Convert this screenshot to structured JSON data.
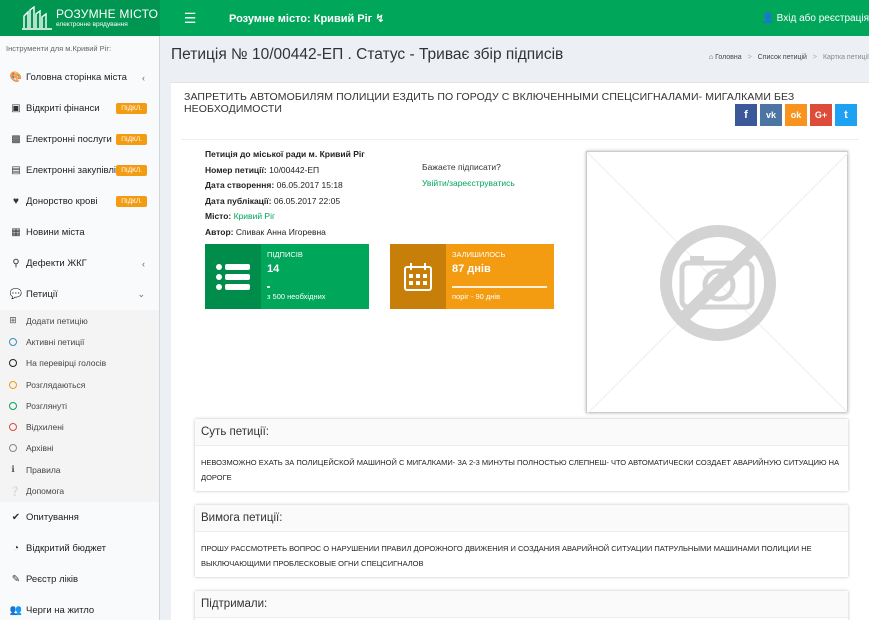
{
  "header": {
    "logo_line1": "РОЗУМНЕ МІСТО",
    "logo_line2": "електронне врядування",
    "menu_icon": "hamburger-icon",
    "city": "Розумне місто: Кривий Ріг",
    "login": "Вхід або реєстрація"
  },
  "sidebar": {
    "heading": "Інструменти для м.Кривий Ріг:",
    "badge": "ПІДКЛ.",
    "items": [
      {
        "label": "Головна сторінка міста",
        "icon": "palette-icon"
      },
      {
        "label": "Відкриті фінанси",
        "icon": "credit-card-icon"
      },
      {
        "label": "Електронні послуги",
        "icon": "briefcase-icon"
      },
      {
        "label": "Електронні закупівлі",
        "icon": "money-icon"
      },
      {
        "label": "Донорство крові",
        "icon": "heartbeat-icon"
      },
      {
        "label": "Новини міста",
        "icon": "newspaper-icon"
      },
      {
        "label": "Дефекти ЖКГ",
        "icon": "search-icon"
      },
      {
        "label": "Петиції",
        "icon": "comment-icon"
      }
    ],
    "petition_sub": [
      {
        "label": "Додати петицію"
      },
      {
        "label": "Активні петиції"
      },
      {
        "label": "На перевірці голосів"
      },
      {
        "label": "Розглядаються"
      },
      {
        "label": "Розглянуті"
      },
      {
        "label": "Відхилені"
      },
      {
        "label": "Архівні"
      },
      {
        "label": "Правила"
      },
      {
        "label": "Допомога"
      }
    ],
    "bottom": [
      {
        "label": "Опитування",
        "icon": "check-icon"
      },
      {
        "label": "Відкритий бюджет",
        "icon": "pie-chart-icon"
      },
      {
        "label": "Реєстр ліків",
        "icon": "edit-icon"
      },
      {
        "label": "Черги на житло",
        "icon": "users-icon"
      }
    ]
  },
  "page": {
    "title": "Петиція № 10/00442-ЕП . Статус - Триває збір підписів",
    "breadcrumb": [
      "Головна",
      "Список петицій",
      "Картка петиції"
    ]
  },
  "petition": {
    "header": "ЗАПРЕТИТЬ АВТОМОБИЛЯМ ПОЛИЦИИ ЕЗДИТЬ ПО ГОРОДУ С ВКЛЮЧЕННЫМИ СПЕЦСИГНАЛАМИ- МИГАЛКАМИ БЕЗ НЕОБХОДИМОСТИ",
    "shares": [
      {
        "icon": "facebook-icon",
        "glyph": "f",
        "color": "#3b5998"
      },
      {
        "icon": "vk-icon",
        "glyph": "vk",
        "color": "#4c75a3"
      },
      {
        "icon": "odnoklassniki-icon",
        "glyph": "ok",
        "color": "#f7931e"
      },
      {
        "icon": "google-plus-icon",
        "glyph": "G+",
        "color": "#dd4b39"
      },
      {
        "icon": "twitter-icon",
        "glyph": "t",
        "color": "#1da1f2"
      }
    ],
    "addressee": "Петиція до міської ради м. Кривий Ріг",
    "number_label": "Номер петиції:",
    "number": "10/00442-ЕП",
    "created_label": "Дата створення:",
    "created": "06.05.2017 15:18",
    "published_label": "Дата публікації:",
    "published": "06.05.2017 22:05",
    "city_label": "Місто:",
    "city": "Кривий Ріг",
    "author_label": "Автор:",
    "author": "Спивак Анна Игоревна",
    "sign_question": "Бажаєте підписати?",
    "sign_link": "Увійти/зареєструватись",
    "signatures": {
      "label": "ПІДПИСІВ",
      "value": "14",
      "sub": "з 500 необхідних",
      "progress": 0.028
    },
    "remaining": {
      "label": "ЗАЛИШИЛОСЬ",
      "value": "87 днів",
      "sub": "поріг - 90 днів",
      "progress": 0.967
    },
    "essence_title": "Суть петиції:",
    "essence_text": "НЕВОЗМОЖНО ЕХАТЬ ЗА ПОЛИЦЕЙСКОЙ МАШИНОЙ С МИГАЛКАМИ- ЗА 2-3 МИНУТЫ ПОЛНОСТЬЮ СЛЕПНЕШ- ЧТО АВТОМАТИЧЕСКИ СОЗДАЕТ АВАРИЙНУЮ СИТУАЦИЮ НА ДОРОГЕ",
    "demand_title": "Вимога петиції:",
    "demand_text": "ПРОШУ РАССМОТРЕТЬ ВОПРОС О НАРУШЕНИИ ПРАВИЛ ДОРОЖНОГО ДВИЖЕНИЯ И СОЗДАНИЯ АВАРИЙНОЙ СИТУАЦИИ ПАТРУЛЬНЫМИ МАШИНАМИ ПОЛИЦИИ НЕ ВЫКЛЮЧАЮЩИМИ ПРОБЛЕСКОВЫЕ ОГНИ СПЕЦСИГНАЛОВ",
    "supported_title": "Підтримали:"
  }
}
